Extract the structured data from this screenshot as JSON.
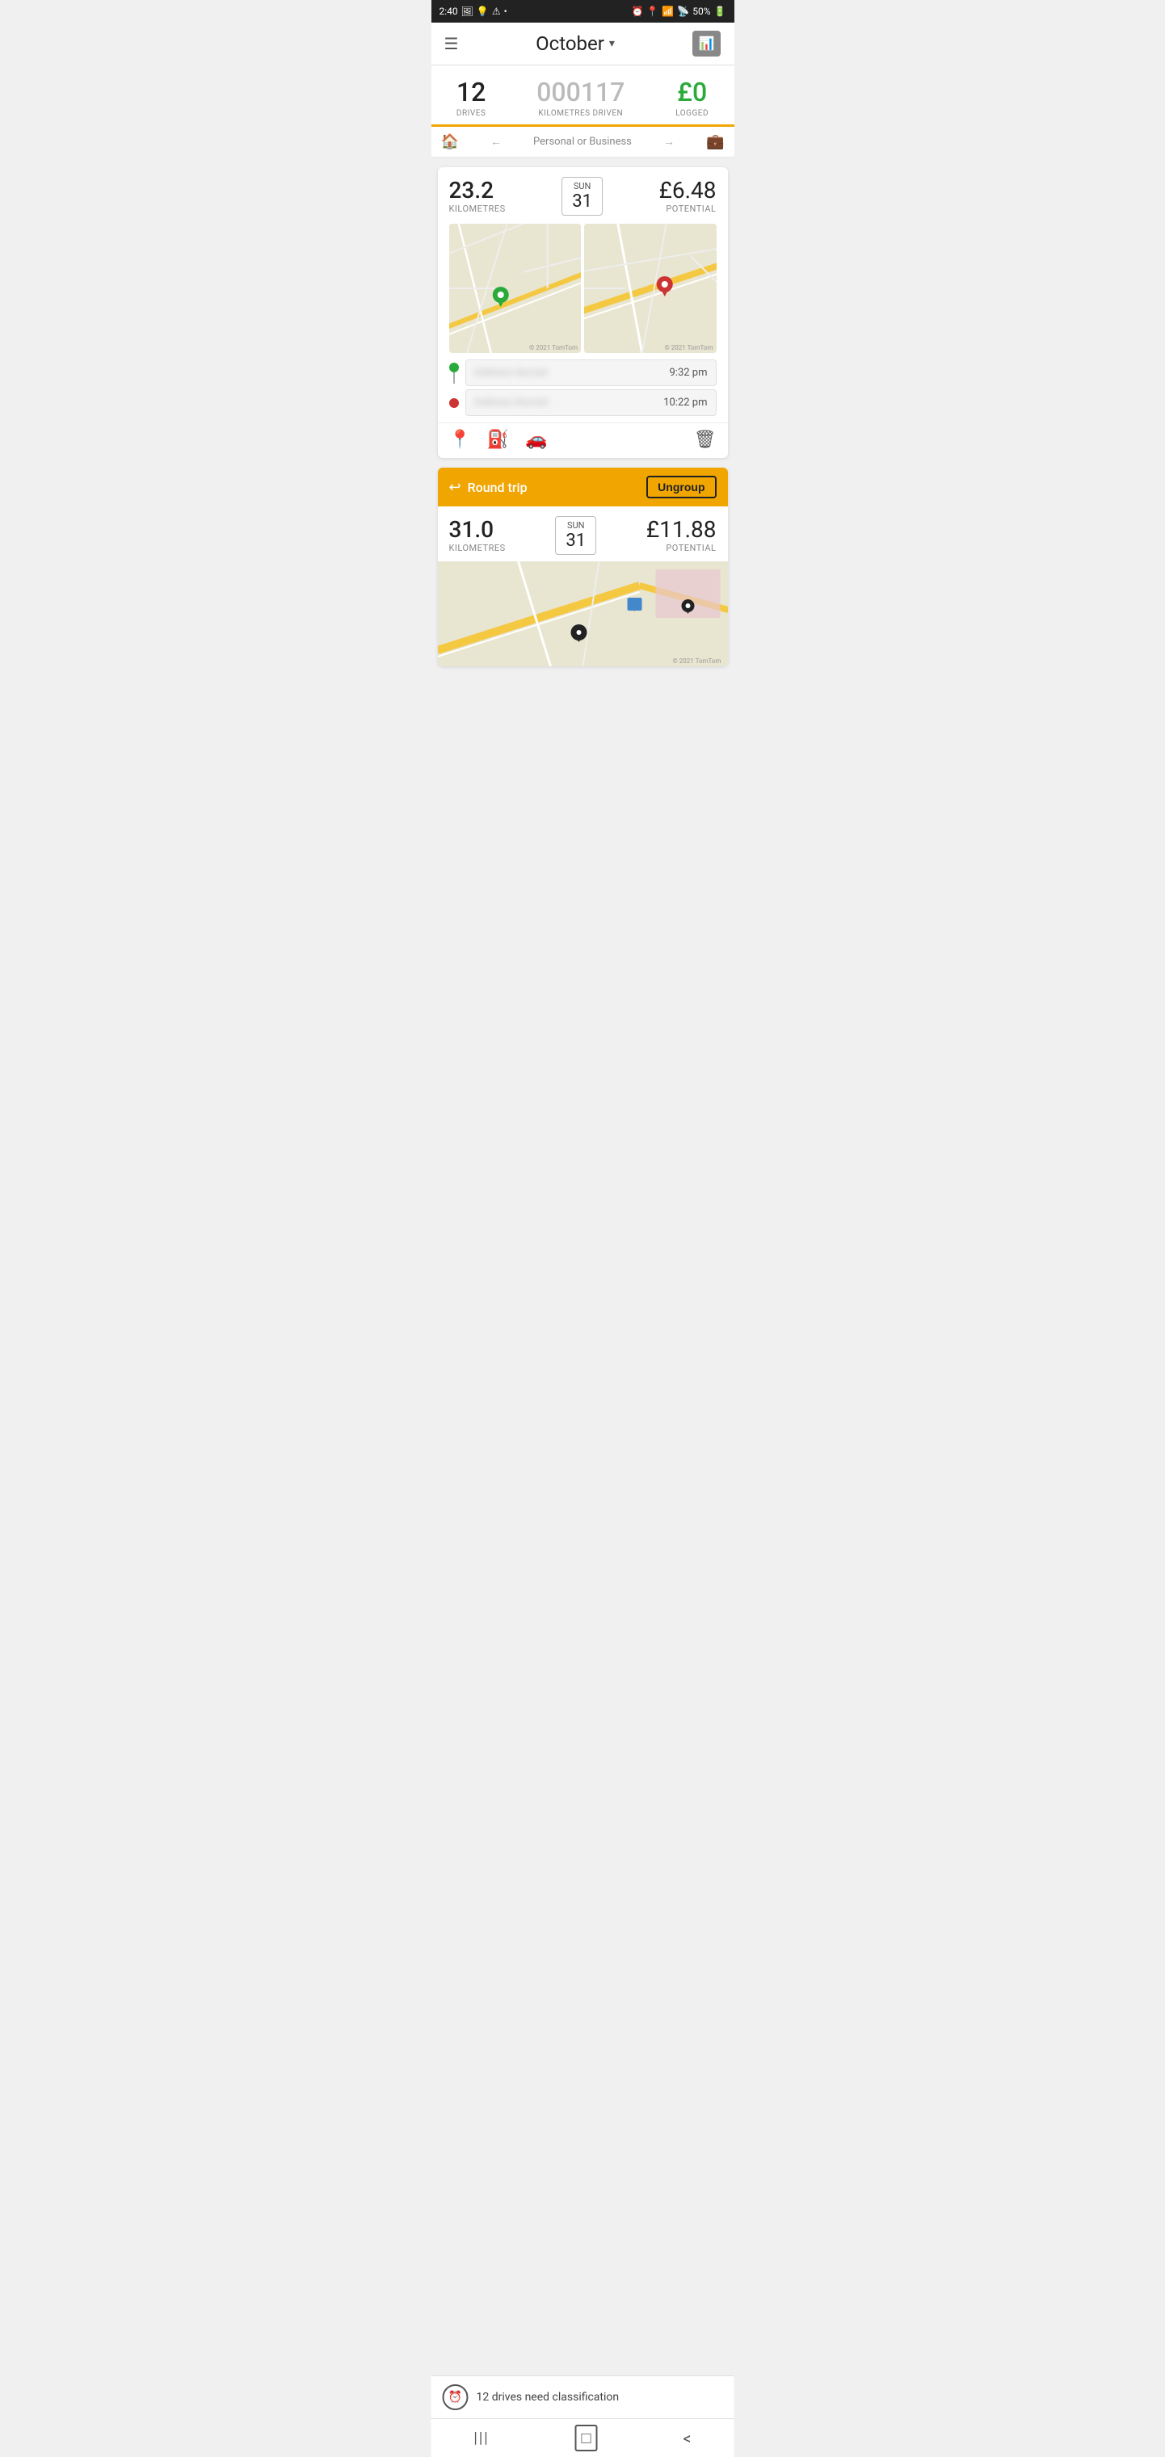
{
  "statusBar": {
    "time": "2:40",
    "battery": "50%"
  },
  "header": {
    "menuIcon": "☰",
    "title": "October",
    "dropdownArrow": "▾",
    "chartIcon": "▦"
  },
  "stats": {
    "drives": {
      "value": "12",
      "label": "DRIVES"
    },
    "kilometres": {
      "value": "000117",
      "label": "KILOMETRES DRIVEN"
    },
    "logged": {
      "value": "£0",
      "label": "LOGGED"
    }
  },
  "personalBusiness": {
    "text": "Personal or Business",
    "homeIcon": "🏠",
    "briefcaseIcon": "💼"
  },
  "driveCard": {
    "kilometres": "23.2",
    "kmLabel": "KILOMETRES",
    "dayName": "SUN",
    "dayNumber": "31",
    "potential": "£6.48",
    "potentialLabel": "POTENTIAL",
    "mapCopyright": "© 2021 TomTom",
    "startAddress": "··········",
    "startTime": "9:32 pm",
    "endAddress": "··········",
    "endTime": "10:22 pm"
  },
  "actionIcons": {
    "location": "📍",
    "fuel": "⛽",
    "car": "🚗",
    "trash": "🗑"
  },
  "roundTrip": {
    "icon": "↩",
    "label": "Round trip",
    "ungroupLabel": "Ungroup",
    "kilometres": "31.0",
    "kmLabel": "KILOMETRES",
    "dayName": "SUN",
    "dayNumber": "31",
    "potential": "£11.88",
    "potentialLabel": "POTENTIAL",
    "mapCopyright": "© 2021 TomTom"
  },
  "bottomNotification": {
    "text": "12 drives need classification"
  },
  "bottomNav": {
    "menuIcon": "|||",
    "homeIcon": "□",
    "backIcon": "<"
  }
}
